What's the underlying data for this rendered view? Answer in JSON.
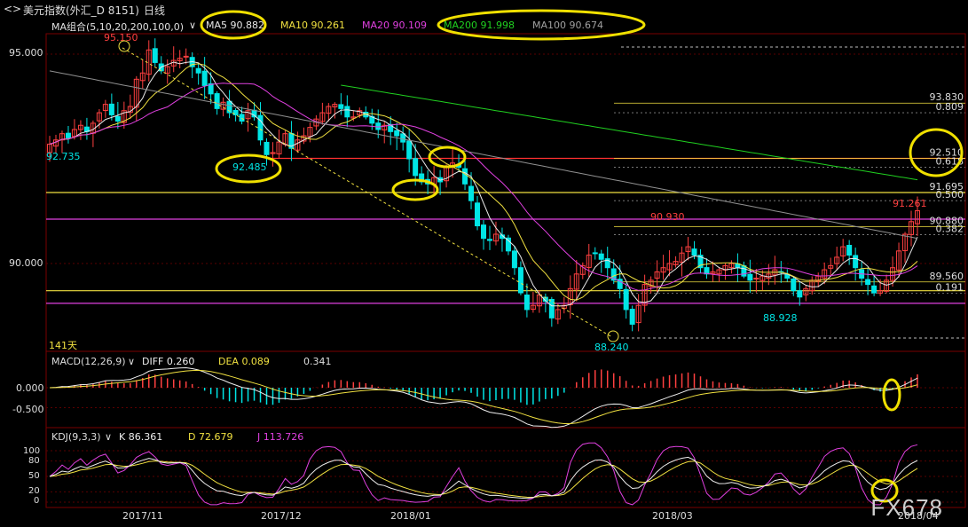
{
  "window": {
    "nav_left": "<",
    "nav_right": ">",
    "instrument": "美元指数(外汇_D 8151)",
    "period": "日线"
  },
  "price_panel": {
    "ma_group": "MA组合(5,10,20,200,100,0)",
    "ma5": "MA5 90.882",
    "ma10": "MA10 90.261",
    "ma20": "MA20 90.109",
    "ma200": "MA200 91.998",
    "ma100": "MA100 90.674",
    "axis_top": "95.000",
    "axis_mid": "90.000",
    "days_label": "141天"
  },
  "macd_panel": {
    "title": "MACD(12,26,9)",
    "diff": "DIFF  0.260",
    "dea": "DEA  0.089",
    "macd": "0.341",
    "axis_zero": "0.000",
    "axis_neg": "-0.500"
  },
  "kdj_panel": {
    "title": "KDJ(9,3,3)",
    "k": "K  86.361",
    "d": "D  72.679",
    "j": "J  113.726",
    "axis_labels": [
      "100",
      "80",
      "50",
      "20",
      "0"
    ]
  },
  "x_axis": {
    "labels": [
      "2017/11",
      "2017/12",
      "2018/01",
      "2018/03",
      "2018/04"
    ]
  },
  "watermark": "FX678",
  "colors": {
    "up": "#ff4040",
    "down": "#00e5e5",
    "ma5": "#e8e8e8",
    "ma10": "#f0e040",
    "ma20": "#e040e0",
    "ma200": "#20d020",
    "ma100": "#909090",
    "highlight": "#f0e000"
  },
  "chart_data": [
    {
      "type": "candlestick",
      "title": "美元指数(外汇_D 8151) 日线",
      "ylim": [
        88.0,
        95.5
      ],
      "yticks": [
        90.0,
        95.0
      ],
      "annotations": [
        {
          "text": "95.150",
          "value": 95.15,
          "color": "red",
          "note": "high"
        },
        {
          "text": "92.735",
          "value": 92.735,
          "color": "cyan"
        },
        {
          "text": "92.485",
          "value": 92.485,
          "color": "cyan"
        },
        {
          "text": "90.930",
          "value": 90.93,
          "color": "red"
        },
        {
          "text": "88.928",
          "value": 88.928,
          "color": "cyan"
        },
        {
          "text": "88.240",
          "value": 88.24,
          "color": "cyan",
          "note": "low"
        },
        {
          "text": "91.261",
          "value": 91.261,
          "color": "red"
        }
      ],
      "fib_levels": [
        {
          "label": "93.830",
          "value": 93.83
        },
        {
          "label": "0.809",
          "value": 93.6
        },
        {
          "label": "92.510",
          "value": 92.51
        },
        {
          "label": "0.618",
          "value": 92.3
        },
        {
          "label": "91.695",
          "value": 91.695
        },
        {
          "label": "0.500",
          "value": 91.5
        },
        {
          "label": "90.880",
          "value": 90.88
        },
        {
          "label": "0.382",
          "value": 90.69
        },
        {
          "label": "89.560",
          "value": 89.56
        },
        {
          "label": "0.191",
          "value": 89.29
        }
      ],
      "horizontal_lines": [
        {
          "value": 92.51,
          "color": "red"
        },
        {
          "value": 91.695,
          "color": "yellow"
        },
        {
          "value": 91.06,
          "color": "magenta"
        },
        {
          "value": 89.35,
          "color": "yellow"
        },
        {
          "value": 89.05,
          "color": "magenta"
        }
      ],
      "series_close": [
        92.85,
        92.95,
        93.1,
        93.0,
        93.2,
        93.3,
        93.15,
        93.35,
        93.6,
        93.8,
        93.55,
        93.4,
        93.65,
        93.75,
        94.4,
        94.55,
        95.1,
        94.8,
        94.6,
        94.7,
        94.85,
        94.9,
        94.95,
        94.7,
        94.55,
        94.25,
        94.05,
        93.7,
        93.85,
        93.6,
        93.55,
        93.4,
        93.65,
        93.5,
        92.95,
        92.6,
        92.65,
        92.9,
        93.1,
        92.75,
        92.95,
        93.05,
        93.25,
        93.45,
        93.6,
        93.75,
        93.8,
        93.7,
        93.5,
        93.5,
        93.65,
        93.5,
        93.35,
        93.2,
        93.3,
        93.15,
        93.05,
        92.9,
        92.5,
        92.1,
        91.95,
        91.9,
        92.05,
        91.95,
        92.3,
        92.4,
        92.3,
        91.9,
        91.5,
        90.9,
        90.6,
        90.55,
        90.7,
        90.6,
        90.3,
        89.9,
        89.3,
        88.9,
        89.0,
        89.25,
        89.1,
        88.7,
        88.9,
        89.0,
        89.4,
        89.75,
        89.95,
        90.2,
        90.25,
        90.1,
        89.9,
        89.6,
        89.4,
        88.9,
        88.55,
        89.0,
        89.5,
        89.6,
        89.8,
        89.9,
        90.0,
        90.05,
        90.25,
        90.4,
        90.2,
        89.9,
        89.75,
        89.8,
        89.85,
        89.95,
        90.0,
        89.9,
        89.7,
        89.6,
        89.65,
        89.7,
        89.75,
        89.85,
        89.8,
        89.65,
        89.35,
        89.2,
        89.4,
        89.6,
        89.7,
        89.85,
        89.95,
        90.15,
        90.4,
        90.2,
        89.9,
        89.65,
        89.5,
        89.3,
        89.35,
        89.6,
        89.9,
        90.3,
        90.7,
        91.0,
        91.26
      ]
    },
    {
      "type": "line",
      "title": "MACD(12,26,9)",
      "ylim": [
        -0.8,
        0.6
      ],
      "series": [
        {
          "name": "DIFF",
          "value": 0.26
        },
        {
          "name": "DEA",
          "value": 0.089
        },
        {
          "name": "MACD",
          "value": 0.341
        }
      ]
    },
    {
      "type": "line",
      "title": "KDJ(9,3,3)",
      "ylim": [
        0,
        110
      ],
      "series": [
        {
          "name": "K",
          "value": 86.361
        },
        {
          "name": "D",
          "value": 72.679
        },
        {
          "name": "J",
          "value": 113.726
        }
      ]
    }
  ]
}
